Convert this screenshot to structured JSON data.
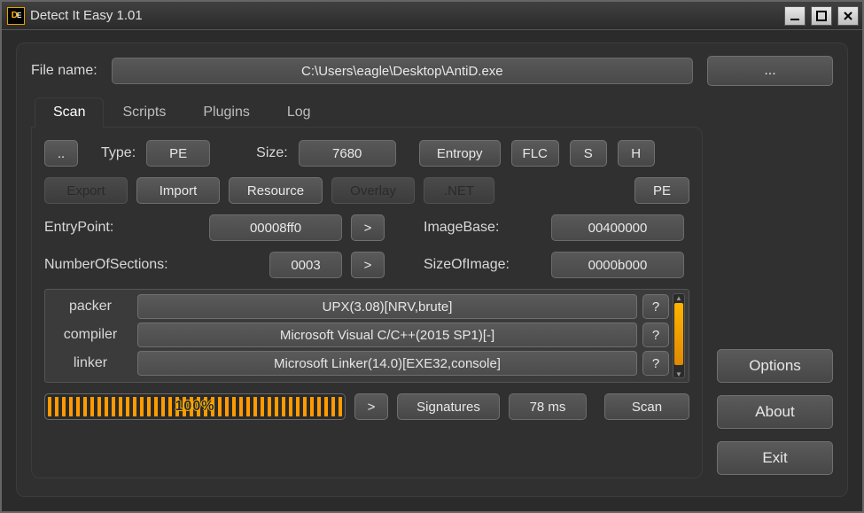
{
  "window": {
    "title": "Detect It Easy 1.01",
    "icon_letters": "DE"
  },
  "file": {
    "label": "File name:",
    "path": "C:\\Users\\eagle\\Desktop\\AntiD.exe",
    "browse_label": "..."
  },
  "tabs": [
    "Scan",
    "Scripts",
    "Plugins",
    "Log"
  ],
  "active_tab": "Scan",
  "scan": {
    "dotdot": "..",
    "type_label": "Type:",
    "type_value": "PE",
    "size_label": "Size:",
    "size_value": "7680",
    "entropy_btn": "Entropy",
    "flc_btn": "FLC",
    "s_btn": "S",
    "h_btn": "H",
    "export_btn": "Export",
    "import_btn": "Import",
    "resource_btn": "Resource",
    "overlay_btn": "Overlay",
    "net_btn": ".NET",
    "pe_btn": "PE",
    "entrypoint_label": "EntryPoint:",
    "entrypoint_value": "00008ff0",
    "gt": ">",
    "imagebase_label": "ImageBase:",
    "imagebase_value": "00400000",
    "sections_label": "NumberOfSections:",
    "sections_value": "0003",
    "sizeofimage_label": "SizeOfImage:",
    "sizeofimage_value": "0000b000",
    "signatures": [
      {
        "category": "packer",
        "value": "UPX(3.08)[NRV,brute]",
        "q": "?"
      },
      {
        "category": "compiler",
        "value": "Microsoft Visual C/C++(2015 SP1)[-]",
        "q": "?"
      },
      {
        "category": "linker",
        "value": "Microsoft Linker(14.0)[EXE32,console]",
        "q": "?"
      }
    ],
    "progress_pct": "100%",
    "signatures_btn": "Signatures",
    "elapsed": "78 ms",
    "scan_btn": "Scan"
  },
  "sidebar": {
    "options": "Options",
    "about": "About",
    "exit": "Exit"
  }
}
